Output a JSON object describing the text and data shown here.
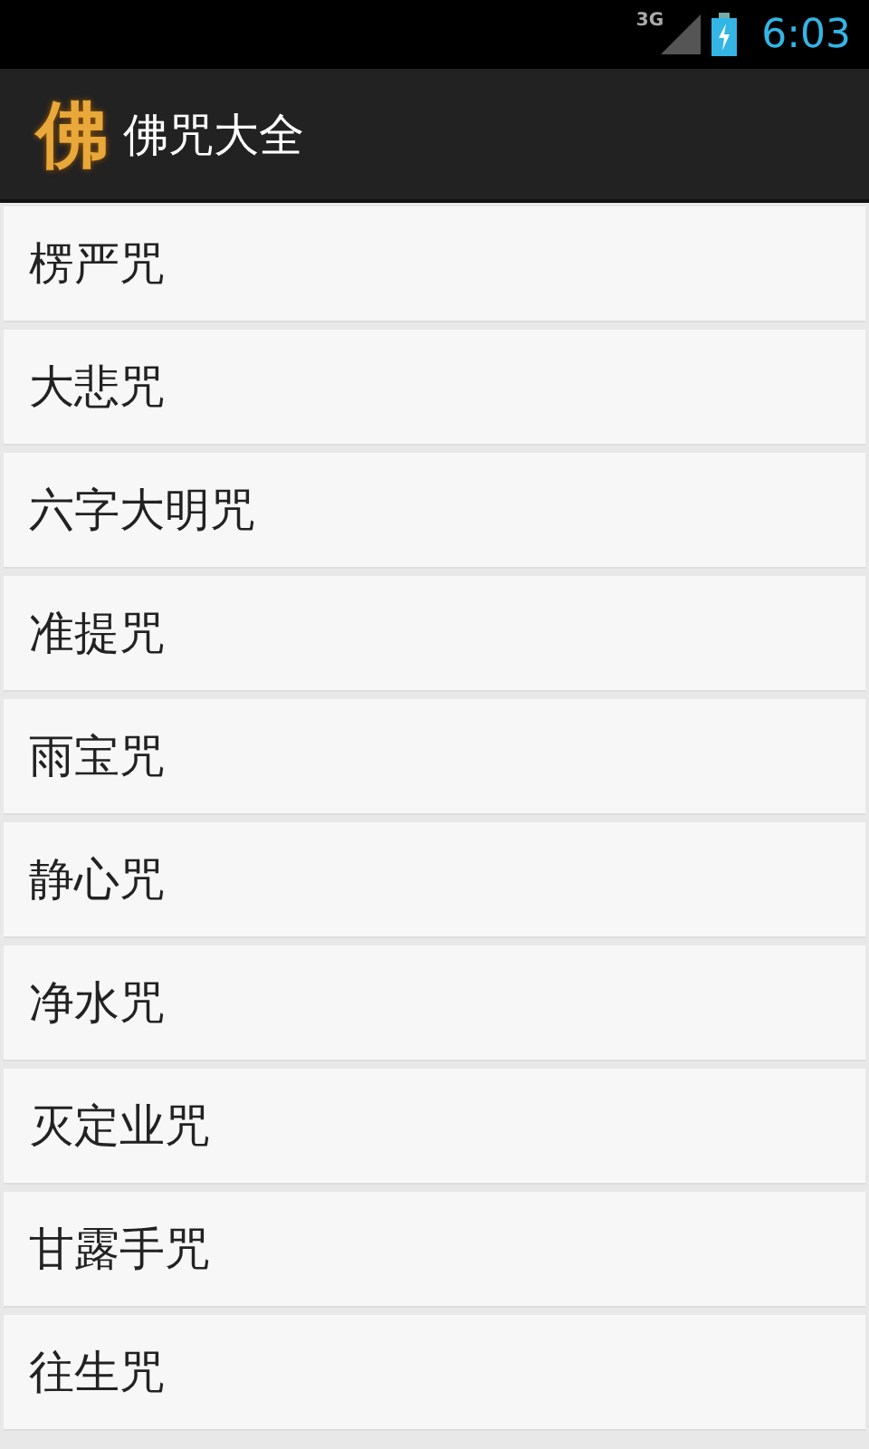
{
  "status_bar": {
    "network": "3G",
    "time": "6:03"
  },
  "app_bar": {
    "logo": "佛",
    "title": "佛咒大全"
  },
  "items": [
    {
      "label": "楞严咒"
    },
    {
      "label": "大悲咒"
    },
    {
      "label": "六字大明咒"
    },
    {
      "label": "准提咒"
    },
    {
      "label": "雨宝咒"
    },
    {
      "label": "静心咒"
    },
    {
      "label": "净水咒"
    },
    {
      "label": "灭定业咒"
    },
    {
      "label": "甘露手咒"
    },
    {
      "label": "往生咒"
    }
  ]
}
